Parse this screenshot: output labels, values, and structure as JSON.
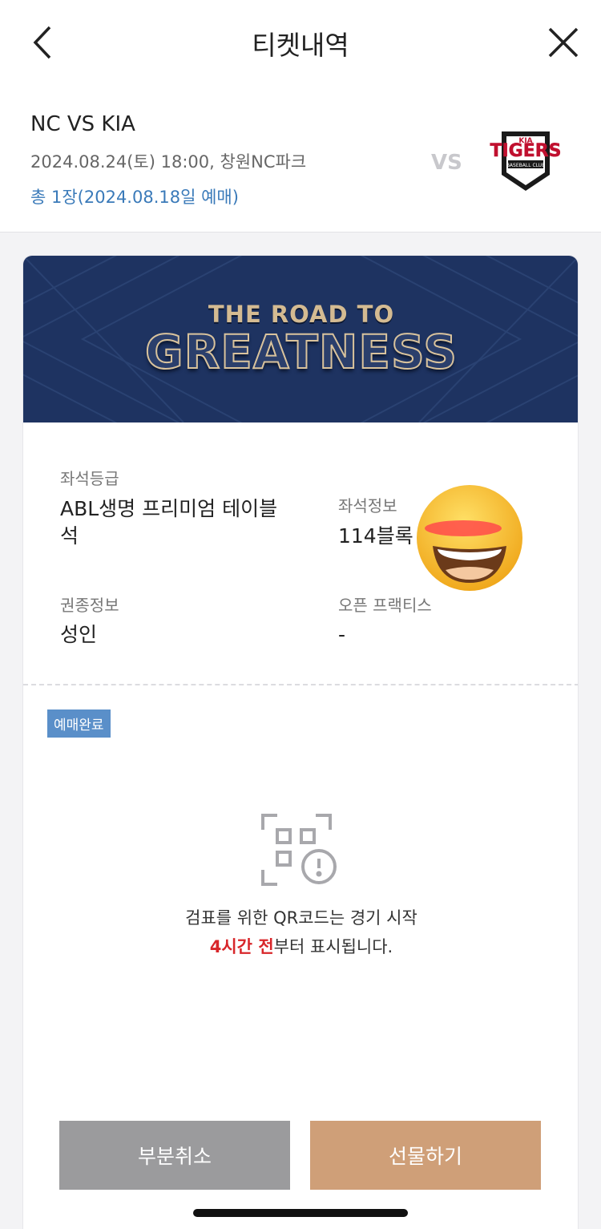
{
  "header": {
    "title": "티켓내역"
  },
  "match": {
    "title": "NC VS KIA",
    "datetime": "2024.08.24(토) 18:00, 창원NC파크",
    "count": "총 1장(2024.08.18일 예매)",
    "vs": "VS",
    "team_logo_icon": "kia-tigers-logo"
  },
  "banner": {
    "line1": "THE ROAD TO",
    "line2": "GREATNESS"
  },
  "seat": {
    "grade_label": "좌석등급",
    "grade_line1": "ABL생명 프리미엄 테이블",
    "grade_line2": "석",
    "info_label": "좌석정보",
    "info_value": "114블록",
    "ticket_type_label": "권종정보",
    "ticket_type_value": "성인",
    "open_practice_label": "오픈 프랙티스",
    "open_practice_value": "-"
  },
  "status": {
    "badge": "예매완료"
  },
  "qr": {
    "icon": "qr-unavailable-icon",
    "message_line1": "검표를 위한 QR코드는 경기 시작",
    "message_highlight": "4시간 전",
    "message_rest": "부터 표시됩니다."
  },
  "actions": {
    "cancel_label": "부분취소",
    "gift_label": "선물하기"
  },
  "colors": {
    "accent_blue": "#3a7ab9",
    "banner_navy": "#1e3361",
    "highlight_red": "#d8262a",
    "cancel_gray": "#9b9b9d",
    "gift_tan": "#cf9f78"
  }
}
